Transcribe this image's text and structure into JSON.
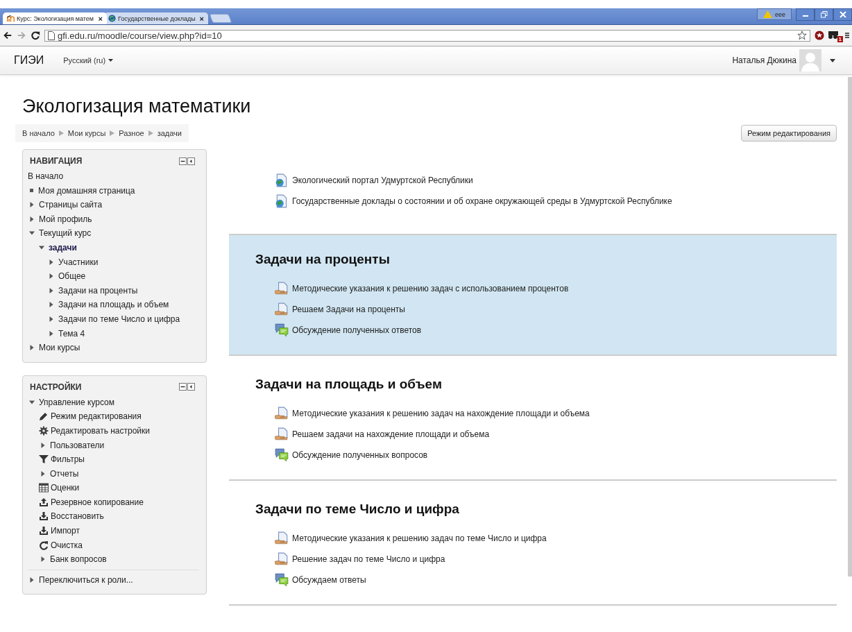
{
  "browser": {
    "tabs": [
      {
        "title": "Курс: Экологизация матем",
        "close": "×",
        "selected": true
      },
      {
        "title": "Государственные доклады",
        "close": "×",
        "selected": false
      }
    ],
    "profile": "eee",
    "url": "gfi.edu.ru/moodle/course/view.php?id=10",
    "extension_badge": "1"
  },
  "navbar": {
    "brand": "ГИЭИ",
    "language": "Русский (ru)",
    "user": "Наталья Дюкина"
  },
  "page": {
    "title": "Экологизация математики",
    "breadcrumb": [
      "В начало",
      "Мои курсы",
      "Разное",
      "задачи"
    ],
    "edit_button": "Режим редактирования"
  },
  "navigation": {
    "title": "НАВИГАЦИЯ",
    "items": [
      {
        "label": "В начало",
        "kind": "plain",
        "current": false
      },
      {
        "label": "Моя домашняя страница",
        "kind": "bullet",
        "current": false
      },
      {
        "label": "Страницы сайта",
        "kind": "branch",
        "expanded": false,
        "current": false
      },
      {
        "label": "Мой профиль",
        "kind": "branch",
        "expanded": false,
        "current": false
      },
      {
        "label": "Текущий курс",
        "kind": "branch",
        "expanded": true,
        "current": false,
        "children": [
          {
            "label": "задачи",
            "kind": "branch",
            "expanded": true,
            "current": true,
            "children": [
              {
                "label": "Участники",
                "kind": "branch",
                "expanded": false,
                "current": false
              },
              {
                "label": "Общее",
                "kind": "branch",
                "expanded": false,
                "current": false
              },
              {
                "label": "Задачи на проценты",
                "kind": "branch",
                "expanded": false,
                "current": false
              },
              {
                "label": "Задачи на площадь и объем",
                "kind": "branch",
                "expanded": false,
                "current": false
              },
              {
                "label": "Задачи по теме Число и цифра",
                "kind": "branch",
                "expanded": false,
                "current": false
              },
              {
                "label": "Тема 4",
                "kind": "branch",
                "expanded": false,
                "current": false
              }
            ]
          }
        ]
      },
      {
        "label": "Мои курсы",
        "kind": "branch",
        "expanded": false,
        "current": false
      }
    ]
  },
  "settings": {
    "title": "НАСТРОЙКИ",
    "items": [
      {
        "label": "Управление курсом",
        "kind": "branch",
        "expanded": true,
        "children": [
          {
            "label": "Режим редактирования",
            "kind": "pencil"
          },
          {
            "label": "Редактировать настройки",
            "kind": "gear"
          },
          {
            "label": "Пользователи",
            "kind": "branch",
            "expanded": false
          },
          {
            "label": "Фильтры",
            "kind": "filter"
          },
          {
            "label": "Отчеты",
            "kind": "branch",
            "expanded": false
          },
          {
            "label": "Оценки",
            "kind": "grades"
          },
          {
            "label": "Резервное копирование",
            "kind": "backup"
          },
          {
            "label": "Восстановить",
            "kind": "restore"
          },
          {
            "label": "Импорт",
            "kind": "restore"
          },
          {
            "label": "Очистка",
            "kind": "reset"
          },
          {
            "label": "Банк вопросов",
            "kind": "branch",
            "expanded": false
          }
        ]
      },
      {
        "label": "Переключиться к роли...",
        "kind": "branch",
        "expanded": false
      }
    ]
  },
  "sections": [
    {
      "highlighted": false,
      "activities": [
        {
          "kind": "url",
          "label": "Экологический портал Удмуртской Республики"
        },
        {
          "kind": "url",
          "label": "Государственные доклады о состоянии и об охране окружающей среды в Удмуртской Республике"
        }
      ]
    },
    {
      "title": "Задачи на проценты",
      "highlighted": true,
      "activities": [
        {
          "kind": "resource",
          "label": "Методические указания к решению задач с использованием процентов"
        },
        {
          "kind": "resource",
          "label": "Решаем Задачи на проценты"
        },
        {
          "kind": "forum",
          "label": "Обсуждение полученных ответов"
        }
      ]
    },
    {
      "title": "Задачи на площадь и объем",
      "highlighted": false,
      "activities": [
        {
          "kind": "resource",
          "label": "Методические указания к решению задач на нахождение площади и объема"
        },
        {
          "kind": "resource",
          "label": "Решаем задачи на нахождение площади и объема"
        },
        {
          "kind": "forum",
          "label": "Обсуждение полученных вопросов"
        }
      ]
    },
    {
      "title": "Задачи по теме Число и цифра",
      "highlighted": false,
      "activities": [
        {
          "kind": "resource",
          "label": "Методические указания к решению задач по теме Число и цифра"
        },
        {
          "kind": "resource",
          "label": "Решение задач по теме Число и цифра"
        },
        {
          "kind": "forum",
          "label": "Обсуждаем ответы"
        }
      ]
    }
  ]
}
